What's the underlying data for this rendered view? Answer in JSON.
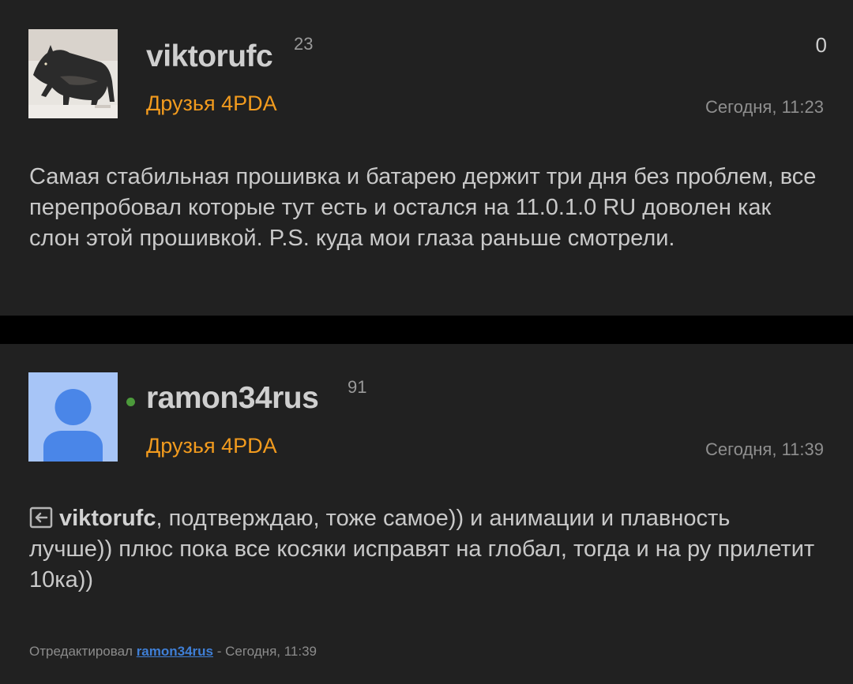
{
  "posts": [
    {
      "username": "viktorufc",
      "reputation": "23",
      "group": "Друзья 4PDA",
      "timestamp": "Сегодня, 11:23",
      "votes": "0",
      "body": "Самая стабильная прошивка и батарею держит три дня без проблем, все перепробовал которые тут есть и остался на 11.0.1.0 RU доволен как слон этой прошивкой. P.S. куда мои глаза раньше смотрели.",
      "avatar_icon": "wolf-avatar"
    },
    {
      "username": "ramon34rus",
      "reputation": "91",
      "online": true,
      "group": "Друзья 4PDA",
      "timestamp": "Сегодня, 11:39",
      "quote_icon": "quote-reply-icon",
      "mention": "viktorufc",
      "body": ", подтверждаю, тоже самое)) и анимации и плавность лучше)) плюс пока все косяки исправят на глобал, тогда и на ру прилетит 10ка))",
      "edited": {
        "prefix": "Отредактировал ",
        "editor": "ramon34rus",
        "suffix": " - Сегодня, 11:39"
      },
      "avatar_icon": "default-user-avatar"
    }
  ],
  "colors": {
    "background": "#000000",
    "post_background": "#212121",
    "group": "#f29b1e",
    "online": "#4c9a3b",
    "link": "#3f7fd6"
  }
}
